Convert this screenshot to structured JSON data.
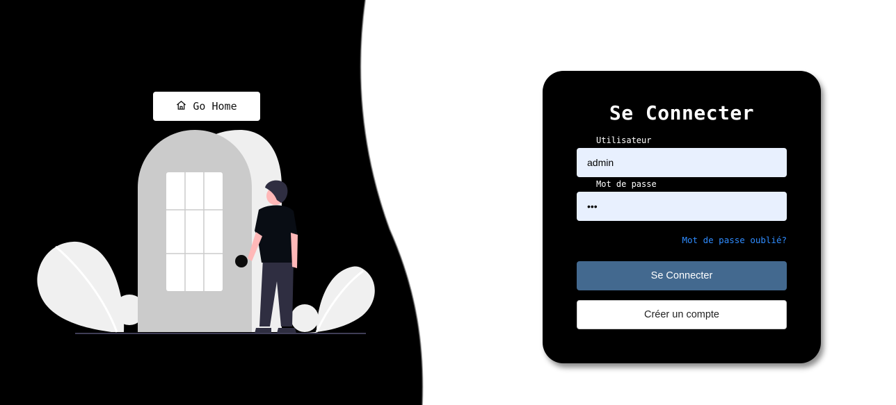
{
  "nav": {
    "home_label": "Go Home",
    "home_icon": "home-icon"
  },
  "login": {
    "title": "Se Connecter",
    "username_label": "Utilisateur",
    "username_value": "admin",
    "password_label": "Mot de passe",
    "password_value": "123",
    "forgot_label": "Mot de passe oublié?",
    "submit_label": "Se Connecter",
    "register_label": "Créer un compte"
  },
  "colors": {
    "panel": "#000000",
    "input_bg": "#e8f0fe",
    "primary_button": "#43698f",
    "link": "#2f8cff"
  }
}
